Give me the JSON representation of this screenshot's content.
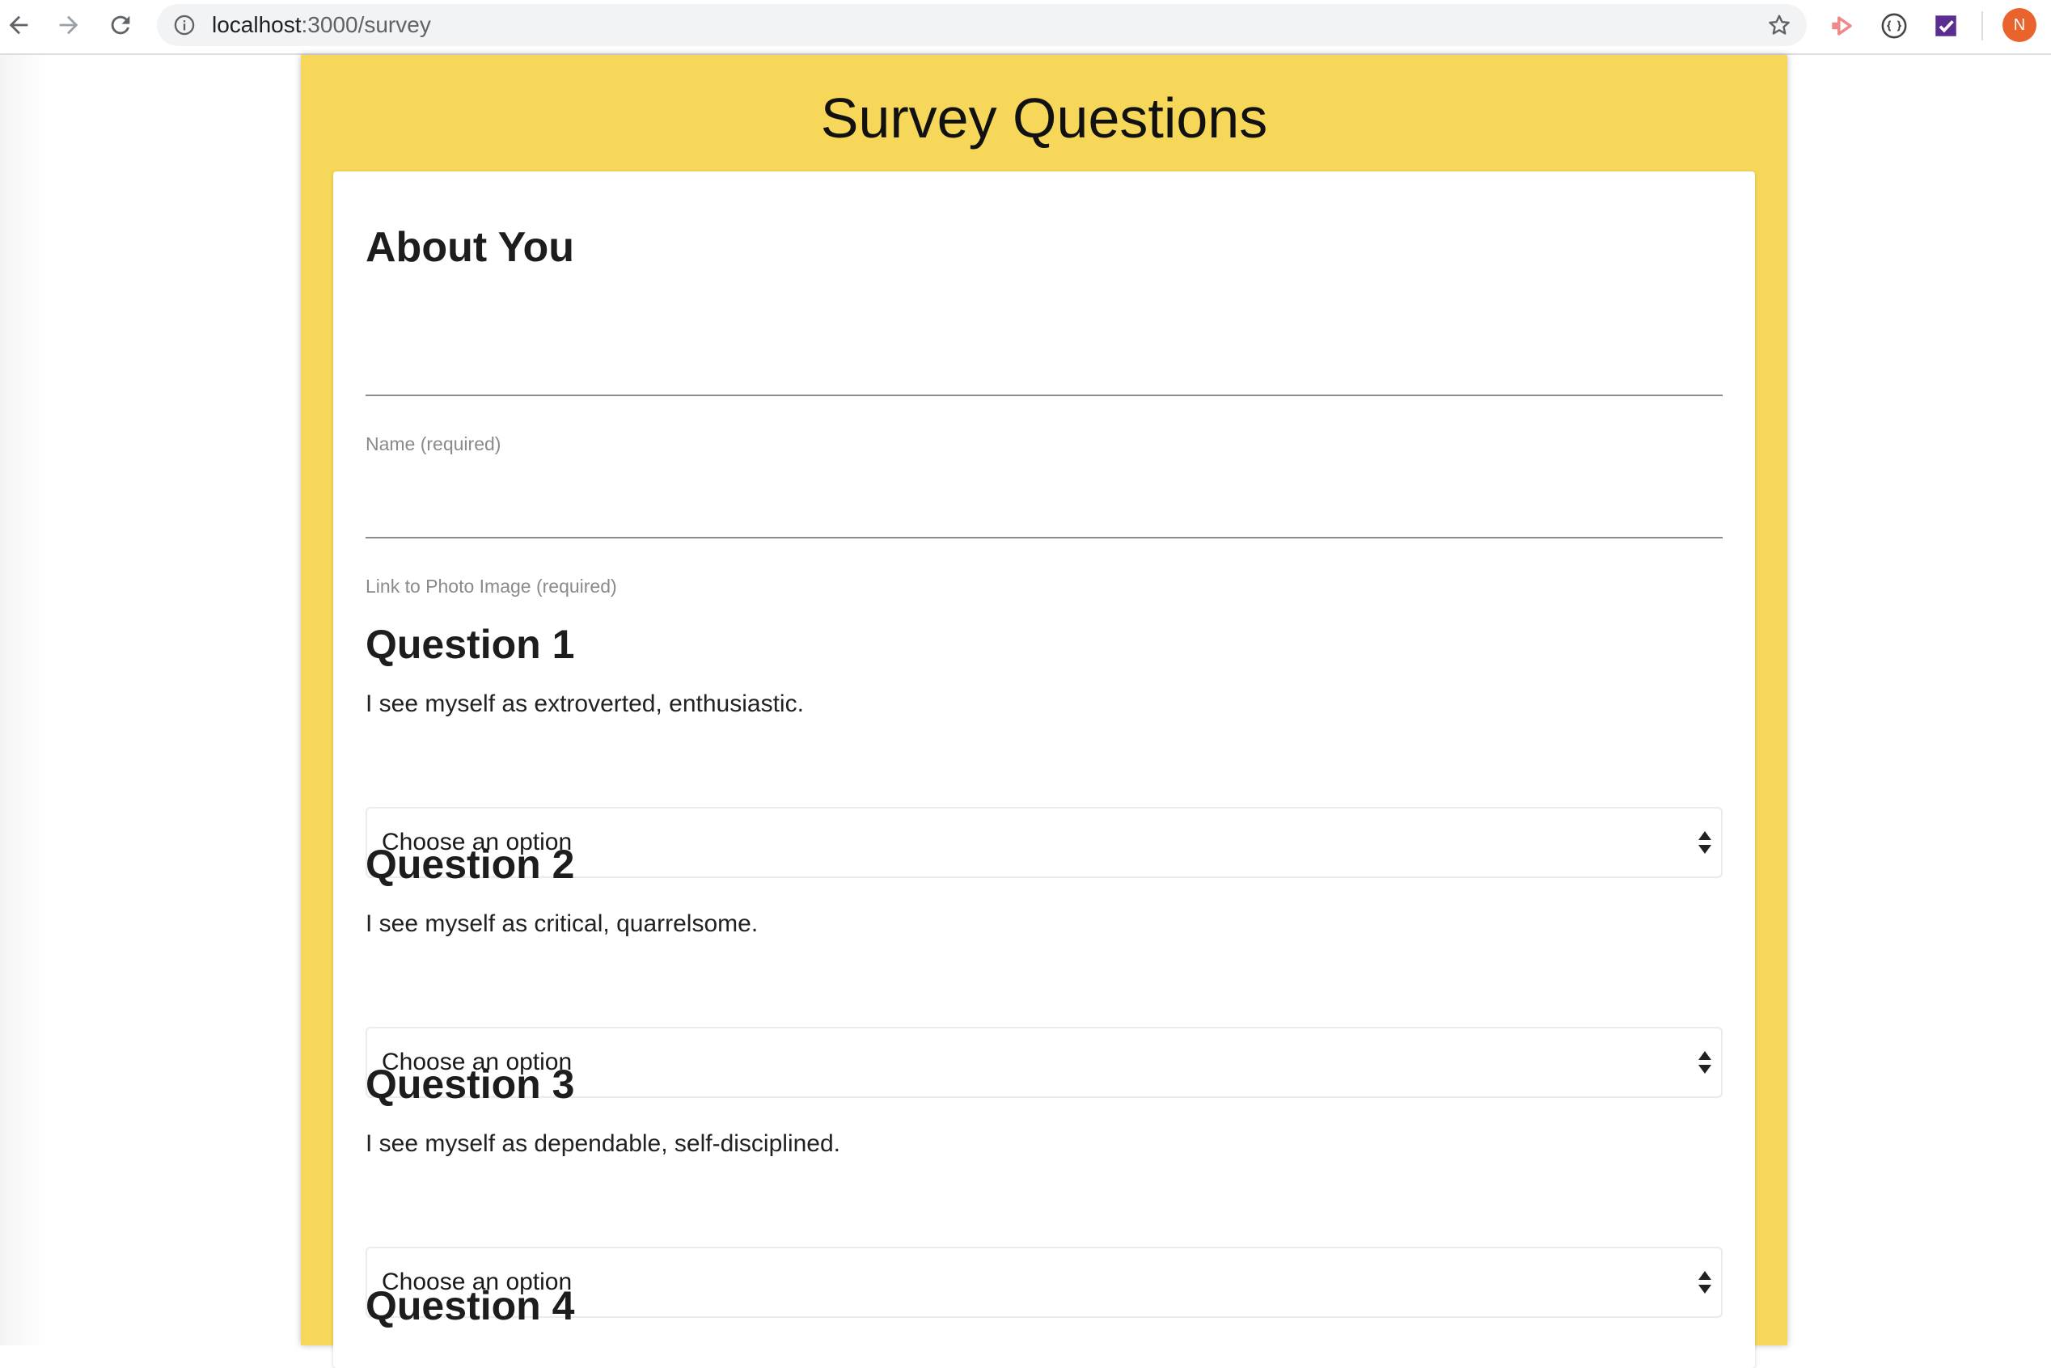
{
  "browser": {
    "url_host": "localhost",
    "url_path": ":3000/survey",
    "avatar_letter": "N",
    "icons": [
      "back-arrow-icon",
      "forward-arrow-icon",
      "reload-icon",
      "info-icon",
      "star-icon",
      "extension-arrow-icon",
      "extension-brackets-icon",
      "extension-checkbox-icon"
    ]
  },
  "page": {
    "title": "Survey Questions",
    "about_heading": "About You",
    "fields": [
      {
        "label": "Name (required)",
        "value": ""
      },
      {
        "label": "Link to Photo Image (required)",
        "value": ""
      }
    ],
    "questions": [
      {
        "title": "Question 1",
        "text": "I see myself as extroverted, enthusiastic.",
        "selected": "Choose an option"
      },
      {
        "title": "Question 2",
        "text": "I see myself as critical, quarrelsome.",
        "selected": "Choose an option"
      },
      {
        "title": "Question 3",
        "text": "I see myself as dependable, self-disciplined.",
        "selected": "Choose an option"
      },
      {
        "title": "Question 4"
      }
    ]
  },
  "colors": {
    "panel_yellow": "#f6d759",
    "avatar": "#e8642c",
    "ext_arrow": "#f08a8a",
    "ext_checkbox": "#5b2d91"
  }
}
